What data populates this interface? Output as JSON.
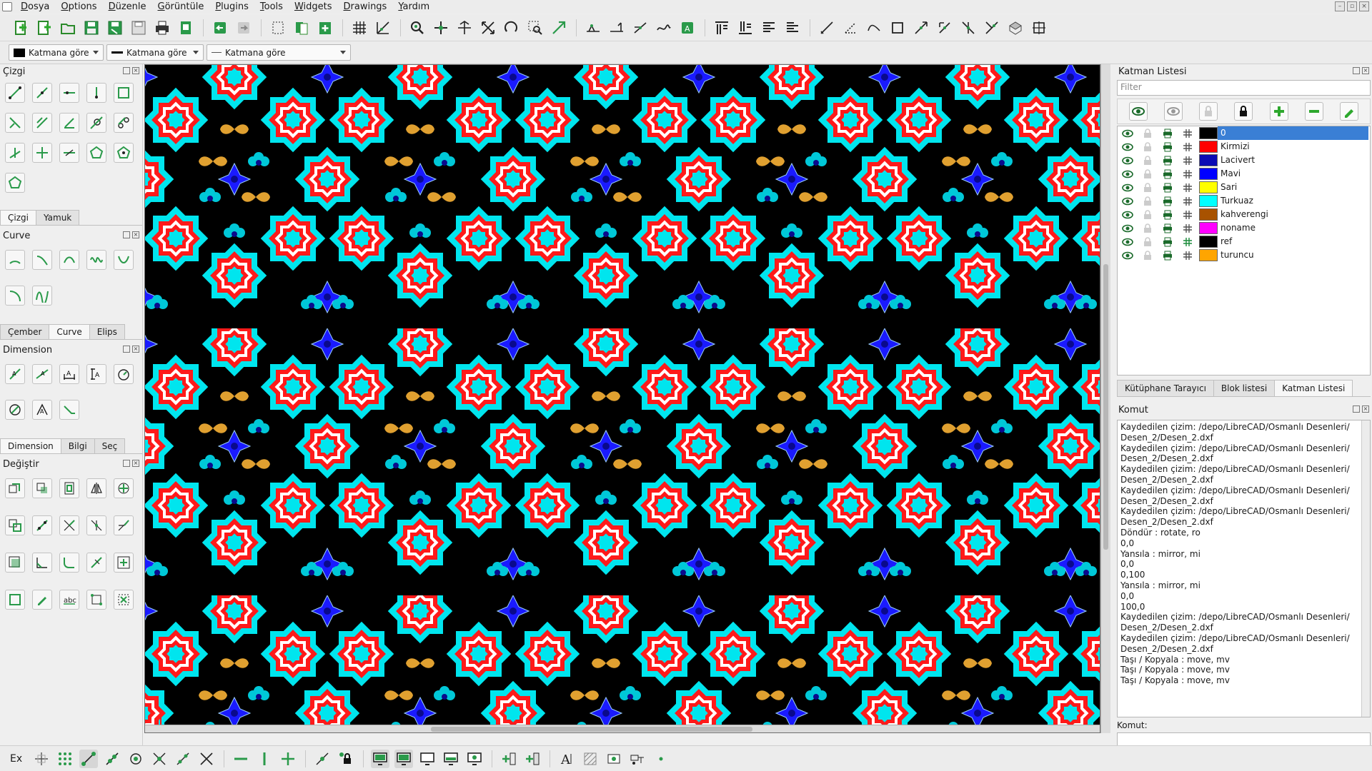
{
  "menubar": {
    "items": [
      "Dosya",
      "Options",
      "Düzenle",
      "Görüntüle",
      "Plugins",
      "Tools",
      "Widgets",
      "Drawings",
      "Yardım"
    ]
  },
  "toolbar2": {
    "color_combo": "Katmana göre",
    "width_combo": "Katmana göre",
    "linetype_combo": "Katmana göre"
  },
  "left_dock": {
    "line_panel_title": "Çizgi",
    "line_tabs": [
      "Çizgi",
      "Yamuk"
    ],
    "curve_panel_title": "Curve",
    "curve_tabs": [
      "Çember",
      "Curve",
      "Elips"
    ],
    "dimension_panel_title": "Dimension",
    "dimension_tabs": [
      "Dimension",
      "Bilgi",
      "Seç"
    ],
    "modify_panel_title": "Değiştir"
  },
  "right_dock": {
    "layer_panel_title": "Katman Listesi",
    "filter_placeholder": "Filter",
    "layers": [
      {
        "name": "0",
        "color": "#000000",
        "selected": true
      },
      {
        "name": "Kirmizi",
        "color": "#ff0000",
        "selected": false
      },
      {
        "name": "Lacivert",
        "color": "#0a0ab4",
        "selected": false
      },
      {
        "name": "Mavi",
        "color": "#0000ff",
        "selected": false
      },
      {
        "name": "Sari",
        "color": "#ffff00",
        "selected": false
      },
      {
        "name": "Turkuaz",
        "color": "#00ffff",
        "selected": false
      },
      {
        "name": "kahverengi",
        "color": "#a85200",
        "selected": false
      },
      {
        "name": "noname",
        "color": "#ff00ff",
        "selected": false
      },
      {
        "name": "ref",
        "color": "#000000",
        "selected": false
      },
      {
        "name": "turuncu",
        "color": "#ffa500",
        "selected": false
      }
    ],
    "bottom_tabs": [
      "Kütüphane Tarayıcı",
      "Blok listesi",
      "Katman Listesi"
    ],
    "command_panel_title": "Komut",
    "command_history": [
      "Kaydedilen çizim: /depo/LibreCAD/Osmanlı Desenleri/",
      "Desen_2/Desen_2.dxf",
      "Kaydedilen çizim: /depo/LibreCAD/Osmanlı Desenleri/",
      "Desen_2/Desen_2.dxf",
      "Kaydedilen çizim: /depo/LibreCAD/Osmanlı Desenleri/",
      "Desen_2/Desen_2.dxf",
      "Kaydedilen çizim: /depo/LibreCAD/Osmanlı Desenleri/",
      "Desen_2/Desen_2.dxf",
      "Kaydedilen çizim: /depo/LibreCAD/Osmanlı Desenleri/",
      "Desen_2/Desen_2.dxf",
      "Döndür : rotate, ro",
      "0,0",
      "Yansıla : mirror, mi",
      "0,0",
      "0,100",
      "Yansıla : mirror, mi",
      "0,0",
      "100,0",
      "Kaydedilen çizim: /depo/LibreCAD/Osmanlı Desenleri/",
      "Desen_2/Desen_2.dxf",
      "Kaydedilen çizim: /depo/LibreCAD/Osmanlı Desenleri/",
      "Desen_2/Desen_2.dxf",
      "Taşı / Kopyala : move, mv",
      "Taşı / Kopyala : move, mv",
      "Taşı / Kopyala : move, mv"
    ],
    "command_label": "Komut:"
  },
  "statusbar": {
    "ex_label": "Ex"
  },
  "colors": {
    "turquoise": "#00e5ee",
    "red": "#ff1a1a",
    "blue": "#1a1aff",
    "navy": "#0a0a8c",
    "gold": "#e0a030",
    "canvas_bg": "#000000"
  }
}
